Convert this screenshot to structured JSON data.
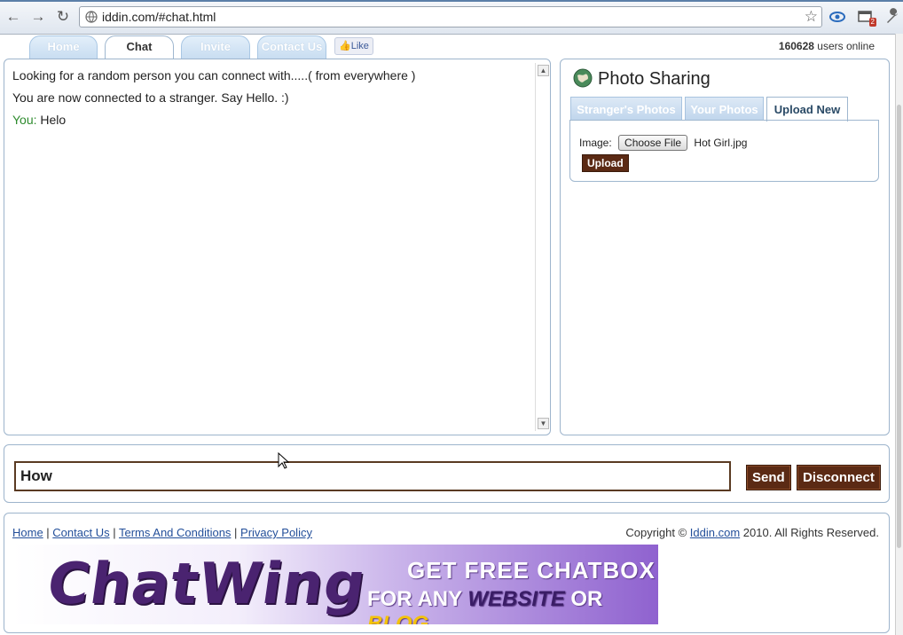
{
  "browser": {
    "url": "iddin.com/#chat.html",
    "extension_badge": "2"
  },
  "nav": {
    "tabs": [
      {
        "label": "Home"
      },
      {
        "label": "Chat"
      },
      {
        "label": "Invite"
      },
      {
        "label": "Contact Us"
      }
    ],
    "like_label": "Like",
    "online_count": "160628",
    "online_suffix": "users online"
  },
  "chat": {
    "messages": [
      {
        "text": "Looking for a random person you can connect with.....( from everywhere )"
      },
      {
        "text": "You are now connected to a stranger. Say Hello. :)"
      },
      {
        "speaker": "You:",
        "text": "Helo"
      }
    ]
  },
  "photo": {
    "title": "Photo Sharing",
    "tabs": [
      {
        "label": "Stranger's Photos"
      },
      {
        "label": "Your Photos"
      },
      {
        "label": "Upload New"
      }
    ],
    "image_label": "Image:",
    "choose_file_label": "Choose File",
    "file_name": "Hot Girl.jpg",
    "upload_label": "Upload"
  },
  "composer": {
    "value": "How",
    "send_label": "Send",
    "disconnect_label": "Disconnect"
  },
  "footer": {
    "links": [
      "Home",
      "Contact Us",
      "Terms And Conditions",
      "Privacy Policy"
    ],
    "copyright_prefix": "Copyright ©",
    "copyright_link": "Iddin.com",
    "copyright_suffix": "2010. All Rights Reserved.",
    "banner": {
      "logo": "ChatWing",
      "line1": "Get free chatbox",
      "line2_prefix": "for any",
      "line2_website": "Website",
      "line2_or": "or",
      "line2_blog": "Blog"
    }
  },
  "colors": {
    "button_brown": "#5b2a14",
    "tab_blue": "#c8ddf1",
    "link_blue": "#234f9a",
    "you_green": "#2e8b2e"
  }
}
